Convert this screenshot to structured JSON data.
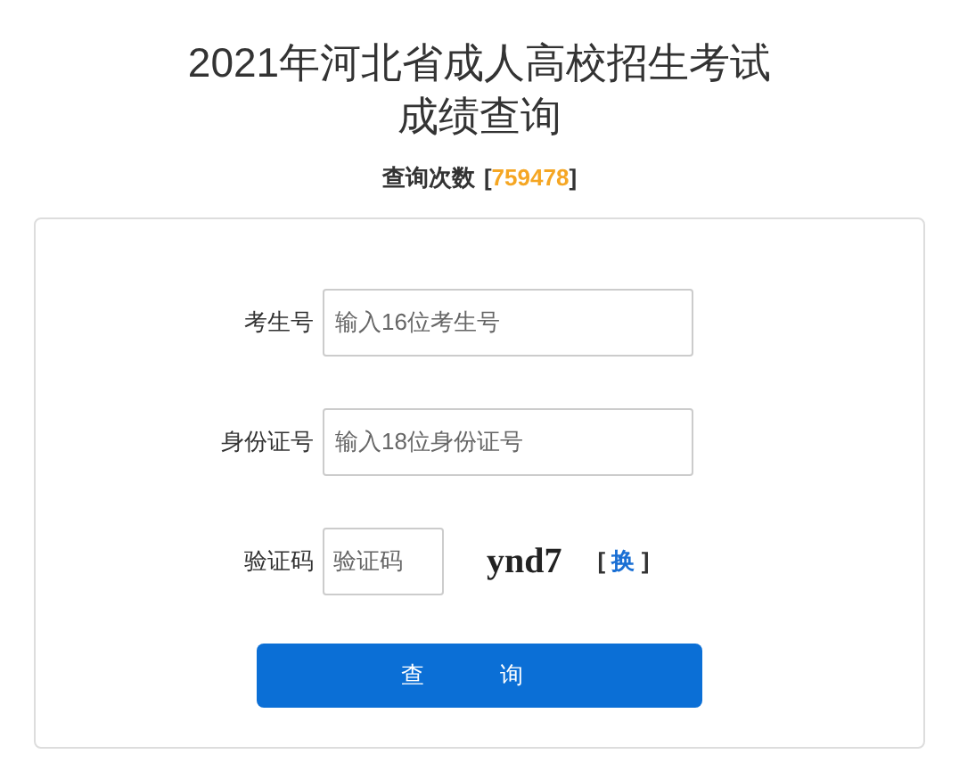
{
  "title": {
    "line1": "2021年河北省成人高校招生考试",
    "line2": "成绩查询"
  },
  "query_count": {
    "label": "查询次数",
    "open": "[",
    "value": "759478",
    "close": "]"
  },
  "form": {
    "fields": [
      {
        "label": "考生号",
        "placeholder": "输入16位考生号",
        "kind": "wide"
      },
      {
        "label": "身份证号",
        "placeholder": "输入18位身份证号",
        "kind": "wide"
      },
      {
        "label": "验证码",
        "placeholder": "验证码",
        "kind": "captcha",
        "captcha": "ynd7",
        "refresh": {
          "open": "[",
          "text": "换",
          "close": "]"
        }
      }
    ],
    "submit": "查 询"
  }
}
